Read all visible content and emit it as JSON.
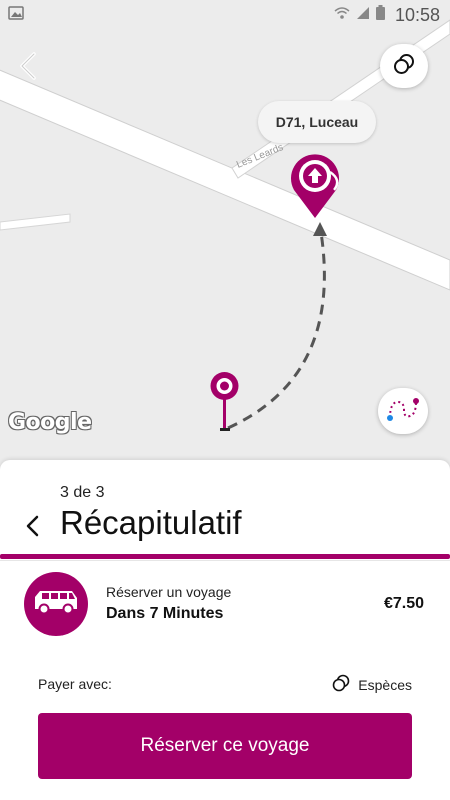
{
  "status_bar": {
    "time": "10:58",
    "icons": [
      "image-icon",
      "wifi-icon",
      "signal-icon",
      "battery-icon"
    ]
  },
  "map": {
    "place_label": "D71, Luceau",
    "street_label": "Les Leards",
    "attribution": "Google",
    "icons": {
      "back": "back-arrow-icon",
      "layers": "layers-icon",
      "route": "route-icon",
      "destination": "destination-pin-icon",
      "origin": "origin-pin-icon"
    }
  },
  "sheet": {
    "step": "3 de 3",
    "title": "Récapitulatif",
    "trip": {
      "label": "Réserver un voyage",
      "time": "Dans 7 Minutes",
      "price": "€7.50",
      "icon": "van-icon"
    },
    "payment": {
      "label": "Payer avec:",
      "method": "Espèces",
      "icon": "coins-icon"
    },
    "book_button": "Réserver ce voyage"
  },
  "colors": {
    "accent": "#a30068",
    "route_dots": [
      "#1e88e5",
      "#a30068"
    ]
  }
}
